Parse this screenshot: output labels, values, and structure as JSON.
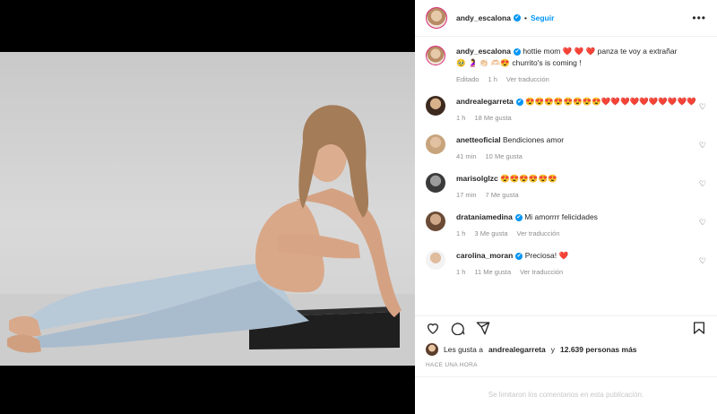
{
  "header": {
    "username": "andy_escalona",
    "verified_mark": "✔",
    "dot": "•",
    "follow_label": "Seguir",
    "more_label": "•••"
  },
  "caption": {
    "username": "andy_escalona",
    "text_1": "hottie mom",
    "hearts": "❤️ ❤️ ❤️",
    "text_2": "panza te voy a extrañar",
    "emojis": "🥹 🤰 👏🏻 🫶🏻😍",
    "text_3": "churrito's is coming !",
    "meta": {
      "edited": "Editado",
      "time": "1 h",
      "translate": "Ver traducción"
    }
  },
  "comments": [
    {
      "username": "andrealegarreta",
      "verified": true,
      "text": "😍😍😍😍😍😍😍😍❤️❤️❤️❤️❤️❤️❤️❤️❤️❤️",
      "time": "1 h",
      "likes": "18 Me gusta",
      "translate": ""
    },
    {
      "username": "anetteoficial",
      "verified": false,
      "text": "Bendiciones amor",
      "time": "41 min",
      "likes": "10 Me gusta",
      "translate": ""
    },
    {
      "username": "marisolglzc",
      "verified": false,
      "text": "😍😍😍😍😍😍",
      "time": "17 min",
      "likes": "7 Me gusta",
      "translate": ""
    },
    {
      "username": "drataniamedina",
      "verified": true,
      "text": "Mi amorrrr felicidades",
      "time": "1 h",
      "likes": "3 Me gusta",
      "translate": "Ver traducción"
    },
    {
      "username": "carolina_moran",
      "verified": true,
      "text": "Preciosa! ❤️",
      "time": "1 h",
      "likes": "11 Me gusta",
      "translate": "Ver traducción"
    }
  ],
  "likes_line": {
    "prefix": "Les gusta a",
    "user": "andrealegarreta",
    "middle": "y",
    "count": "12.639 personas más"
  },
  "timestamp": "HACE UNA HORA",
  "comments_limited": "Se limitaron los comentarios en esta publicación.",
  "icons": [
    "heart-icon",
    "comment-icon",
    "share-icon",
    "bookmark-icon"
  ],
  "colors": {
    "accent": "#0095f6",
    "heart": "#ed4956",
    "muted": "#8e8e8e"
  }
}
